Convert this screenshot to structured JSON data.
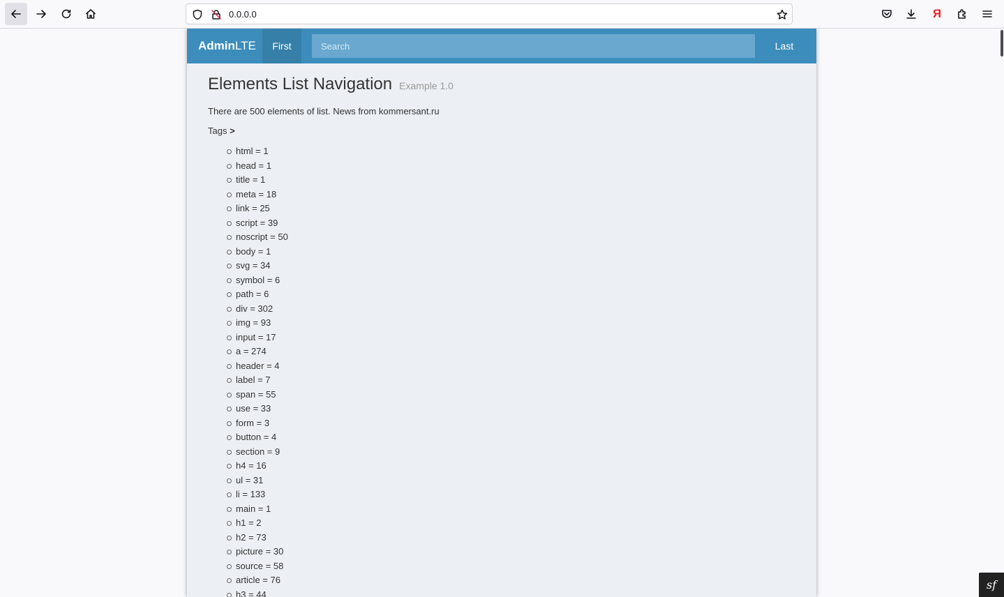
{
  "browser": {
    "url": "0.0.0.0"
  },
  "navbar": {
    "brand_bold": "Admin",
    "brand_light": "LTE",
    "first_label": "First",
    "search_placeholder": "Search",
    "last_label": "Last"
  },
  "page": {
    "title": "Elements List Navigation",
    "subtitle": "Example 1.0",
    "description": "There are 500 elements of list. News from kommersant.ru",
    "tags_label": "Tags",
    "tags_arrow": ">"
  },
  "tags": [
    "html = 1",
    "head = 1",
    "title = 1",
    "meta = 18",
    "link = 25",
    "script = 39",
    "noscript = 50",
    "body = 1",
    "svg = 34",
    "symbol = 6",
    "path = 6",
    "div = 302",
    "img = 93",
    "input = 17",
    "a = 274",
    "header = 4",
    "label = 7",
    "span = 55",
    "use = 33",
    "form = 3",
    "button = 4",
    "section = 9",
    "h4 = 16",
    "ul = 31",
    "li = 133",
    "main = 1",
    "h1 = 2",
    "h2 = 73",
    "picture = 30",
    "source = 58",
    "article = 76",
    "h3 = 44"
  ],
  "colors": {
    "navbar": "#3c8dbc",
    "navbar_active": "#367fa9",
    "content_bg": "#ecf0f5"
  }
}
